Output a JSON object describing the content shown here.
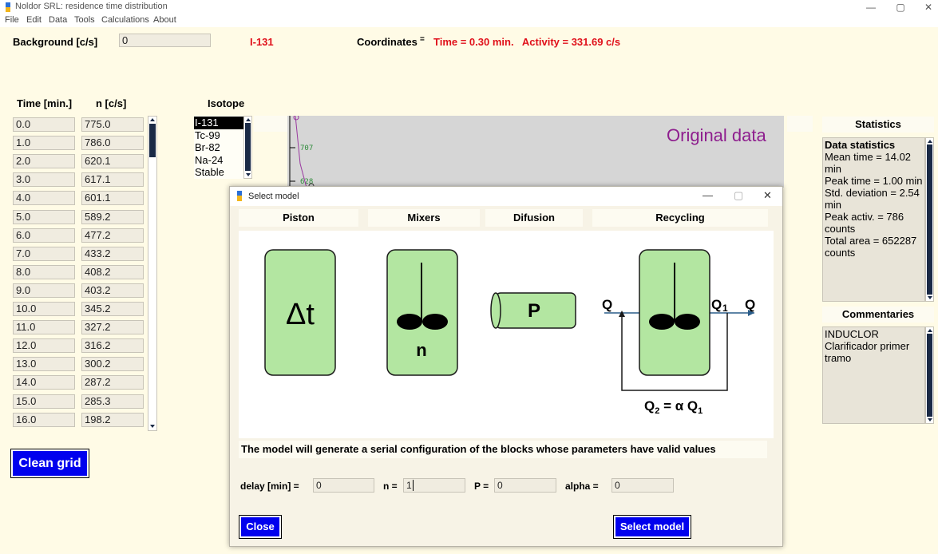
{
  "window": {
    "title": "Noldor SRL: residence time distribution",
    "minimize_glyph": "—",
    "maximize_glyph": "▢",
    "close_glyph": "✕"
  },
  "menu": [
    "File",
    "Edit",
    "Data",
    "Tools",
    "Calculations",
    "About"
  ],
  "top": {
    "background_label": "Background [c/s]",
    "background_value": "0",
    "isotope_display": "I-131",
    "coordinates_label": "Coordinates",
    "coordinates_value": "Time = 0.30 min.   Activity = 331.69 c/s"
  },
  "grid": {
    "time_header": "Time [min.]",
    "n_header": "n [c/s]",
    "rows": [
      {
        "time": "0.0",
        "n": "775.0"
      },
      {
        "time": "1.0",
        "n": "786.0"
      },
      {
        "time": "2.0",
        "n": "620.1"
      },
      {
        "time": "3.0",
        "n": "617.1"
      },
      {
        "time": "4.0",
        "n": "601.1"
      },
      {
        "time": "5.0",
        "n": "589.2"
      },
      {
        "time": "6.0",
        "n": "477.2"
      },
      {
        "time": "7.0",
        "n": "433.2"
      },
      {
        "time": "8.0",
        "n": "408.2"
      },
      {
        "time": "9.0",
        "n": "403.2"
      },
      {
        "time": "10.0",
        "n": "345.2"
      },
      {
        "time": "11.0",
        "n": "327.2"
      },
      {
        "time": "12.0",
        "n": "316.2"
      },
      {
        "time": "13.0",
        "n": "300.2"
      },
      {
        "time": "14.0",
        "n": "287.2"
      },
      {
        "time": "15.0",
        "n": "285.3"
      },
      {
        "time": "16.0",
        "n": "198.2"
      }
    ],
    "clean_button": "Clean grid"
  },
  "isotope": {
    "header": "Isotope",
    "options": [
      "I-131",
      "Tc-99",
      "Br-82",
      "Na-24",
      "Stable"
    ],
    "selected": "I-131"
  },
  "chart": {
    "title": "Original data",
    "tick_labels": [
      "707",
      "628"
    ]
  },
  "statistics": {
    "header": "Statistics",
    "lines": [
      "Data statistics",
      "Mean time = 14.02",
      "min",
      "Peak time = 1.00 min",
      "Std. deviation = 2.54",
      "min",
      "Peak activ. = 786",
      "counts",
      "Total area = 652287",
      "counts"
    ]
  },
  "commentaries": {
    "header": "Commentaries",
    "lines": [
      "INDUCLOR",
      "Clarificador primer",
      "tramo"
    ]
  },
  "dialog": {
    "title": "Select model",
    "headers": {
      "piston": "Piston",
      "mixers": "Mixers",
      "difusion": "Difusion",
      "recycling": "Recycling"
    },
    "diagram": {
      "delta_t": "Δt",
      "n": "n",
      "p": "P",
      "q_in": "Q",
      "q1": "Q",
      "q1_sub": "1",
      "q_out": "Q",
      "q2_eq": "Q",
      "q2_sub": "2",
      "q2_mid": " = α Q",
      "q2_sub_end": "1"
    },
    "info": "The model will generate a serial configuration of the blocks whose parameters have valid values",
    "params": {
      "delay_label": "delay [min] =",
      "delay_value": "0",
      "n_label": "n =",
      "n_value": "1",
      "p_label": "P =",
      "p_value": "0",
      "alpha_label": "alpha =",
      "alpha_value": "0"
    },
    "close_button": "Close",
    "select_button": "Select model"
  },
  "colors": {
    "page_bg": "#fffbe6",
    "accent_blue": "#0000ee",
    "coord_red": "#e0101a",
    "chart_title": "#8e1e8e",
    "block_green": "#b3e6a1"
  },
  "icons": [
    "app-logo-icon",
    "dialog-logo-icon",
    "scroll-up-icon",
    "scroll-down-icon"
  ]
}
